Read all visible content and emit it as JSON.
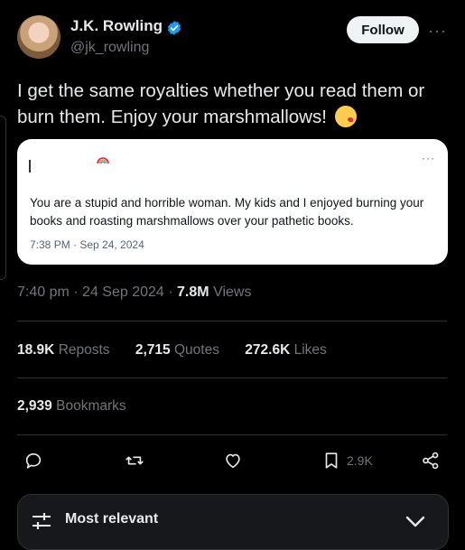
{
  "author": {
    "name": "J.K. Rowling",
    "handle": "@jk_rowling",
    "follow_label": "Follow",
    "more_label": "···"
  },
  "tweet": {
    "text": "I get the same royalties whether you read them or burn them. Enjoy your marshmallows!",
    "emoji": "face-blowing-kiss-emoji"
  },
  "quote": {
    "more_label": "···",
    "text": "You are a stupid and horrible woman. My kids and I enjoyed burning your books and roasting marshmallows over your pathetic books.",
    "timestamp": "7:38 PM · Sep 24, 2024"
  },
  "meta": {
    "time": "7:40 pm",
    "sep1": "·",
    "date": "24 Sep 2024",
    "sep2": "·",
    "views_count": "7.8M",
    "views_label": "Views"
  },
  "stats": {
    "reposts_count": "18.9K",
    "reposts_label": "Reposts",
    "quotes_count": "2,715",
    "quotes_label": "Quotes",
    "likes_count": "272.6K",
    "likes_label": "Likes",
    "bookmarks_count": "2,939",
    "bookmarks_label": "Bookmarks"
  },
  "actions": {
    "reply_icon": "reply-icon",
    "repost_icon": "repost-icon",
    "like_icon": "heart-icon",
    "bookmark_icon": "bookmark-icon",
    "bookmark_count": "2.9K",
    "share_icon": "share-icon"
  },
  "sort": {
    "label": "Most relevant"
  },
  "colors": {
    "background": "#000000",
    "text_primary": "#e7e9ea",
    "text_secondary": "#71767b",
    "verified": "#1d9bf0",
    "divider": "#2f3336"
  }
}
